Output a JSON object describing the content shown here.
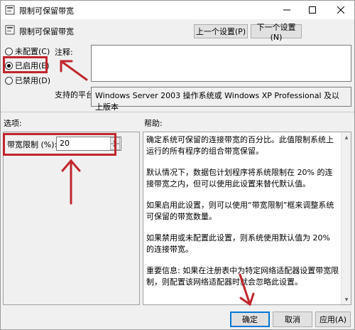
{
  "window": {
    "title": "限制可保留带宽"
  },
  "header": {
    "policy_name": "限制可保留带宽",
    "prev_label": "上一个设置(P)",
    "next_label": "下一个设置(N)"
  },
  "state": {
    "options": [
      {
        "label": "未配置(C)",
        "checked": false
      },
      {
        "label": "已启用(E)",
        "checked": true
      },
      {
        "label": "已禁用(D)",
        "checked": false
      }
    ]
  },
  "comment": {
    "label": "注释:",
    "value": ""
  },
  "platform": {
    "label": "支持的平台:",
    "value": "Windows Server 2003 操作系统或 Windows XP Professional 及以上版本"
  },
  "options_pane": {
    "label": "选项:",
    "bandwidth_label": "带宽限制 (%):",
    "bandwidth_value": "20"
  },
  "help": {
    "label": "帮助:",
    "paragraphs": [
      "确定系统可保留的连接带宽的百分比。此值限制系统上运行的所有程序的组合带宽保留。",
      "默认情况下，数据包计划程序将系统限制在 20% 的连接带宽之内，但可以使用此设置来替代默认值。",
      "如果启用此设置，则可以使用“带宽限制”框来调整系统可保留的带宽数量。",
      "如果禁用或未配置此设置，则系统使用默认值为 20% 的连接带宽。",
      "重要信息: 如果在注册表中为特定网络适配器设置带宽限制，则配置该网络适配器时就会忽略此设置。"
    ]
  },
  "buttons": {
    "ok": "确定",
    "cancel": "取消",
    "apply": "应用(A)"
  },
  "colors": {
    "annotation": "#c0262c",
    "focus": "#0078d7"
  }
}
